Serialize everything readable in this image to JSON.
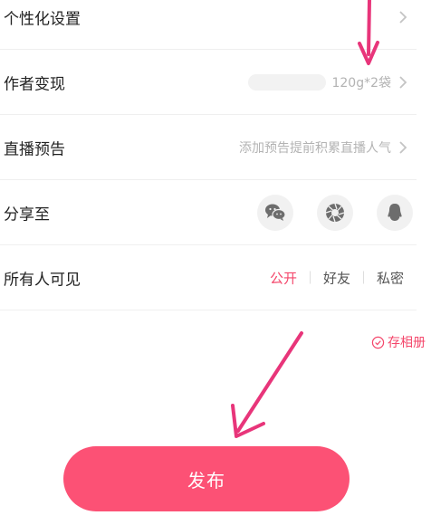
{
  "rows": {
    "personalize": {
      "label": "个性化设置"
    },
    "monetize": {
      "label": "作者变现",
      "value": "120g*2袋"
    },
    "live": {
      "label": "直播预告",
      "hint": "添加预告提前积累直播人气"
    },
    "share": {
      "label": "分享至",
      "targets": [
        "wechat-icon",
        "moments-icon",
        "qq-icon"
      ]
    },
    "visibility": {
      "label": "所有人可见",
      "options": [
        "公开",
        "好友",
        "私密"
      ],
      "selected": "公开"
    }
  },
  "save_album": "存相册",
  "publish_label": "发布",
  "colors": {
    "accent": "#f4476b",
    "publish_bg": "#fc5175",
    "annotation": "#e8357a"
  }
}
